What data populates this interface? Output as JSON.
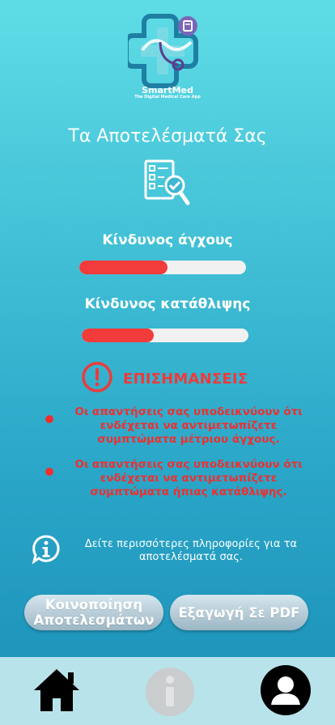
{
  "app": {
    "name": "SmartMed",
    "tagline": "The Digital Medical Care App"
  },
  "results": {
    "title": "Τα Αποτελέσματά Σας",
    "anxiety": {
      "label": "Κίνδυνος άγχους",
      "level": 0.53
    },
    "depression": {
      "label": "Κίνδυνος κατάθλιψης",
      "level": 0.43
    }
  },
  "warnings": {
    "title": "ΕΠΙΣΗΜΑΝΣΕΙΣ",
    "items": [
      "Οι απαντήσεις σας υποδεικνύουν ότι ενδέχεται να αντιμετωπίζετε συμπτώματα μέτριου άγχους.",
      "Οι απαντήσεις σας υποδεικνύουν ότι ενδέχεται να αντιμετωπίζετε συμπτώματα ήπιας κατάθλιψης."
    ]
  },
  "info": {
    "text": "Δείτε περισσότερες πληροφορίες για τα αποτελέσματά σας."
  },
  "actions": {
    "share_label": "Κοινοποίηση Αποτελεσμάτων",
    "export_label": "Εξαγωγή Σε PDF"
  },
  "nav": {
    "icons": [
      "home-icon",
      "info-icon",
      "profile-icon"
    ]
  },
  "colors": {
    "risk_fill": "#f23b3b",
    "warning": "#ef3a3a",
    "nav_background": "#b8e3ea"
  }
}
